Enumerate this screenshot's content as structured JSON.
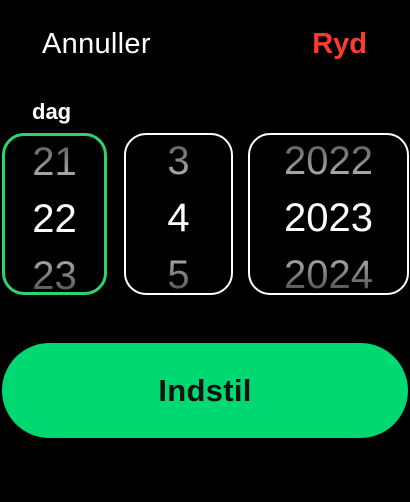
{
  "header": {
    "cancel_label": "Annuller",
    "clear_label": "Ryd"
  },
  "focused_field_label": "dag",
  "pickers": {
    "day": {
      "prev": "21",
      "current": "22",
      "next": "23"
    },
    "month": {
      "prev": "3",
      "current": "4",
      "next": "5"
    },
    "year": {
      "prev": "2022",
      "current": "2023",
      "next": "2024"
    }
  },
  "set_button_label": "Indstil",
  "colors": {
    "background": "#000000",
    "accent_green": "#00d871",
    "focus_ring": "#2bd46e",
    "destructive_red": "#ff3b30"
  }
}
